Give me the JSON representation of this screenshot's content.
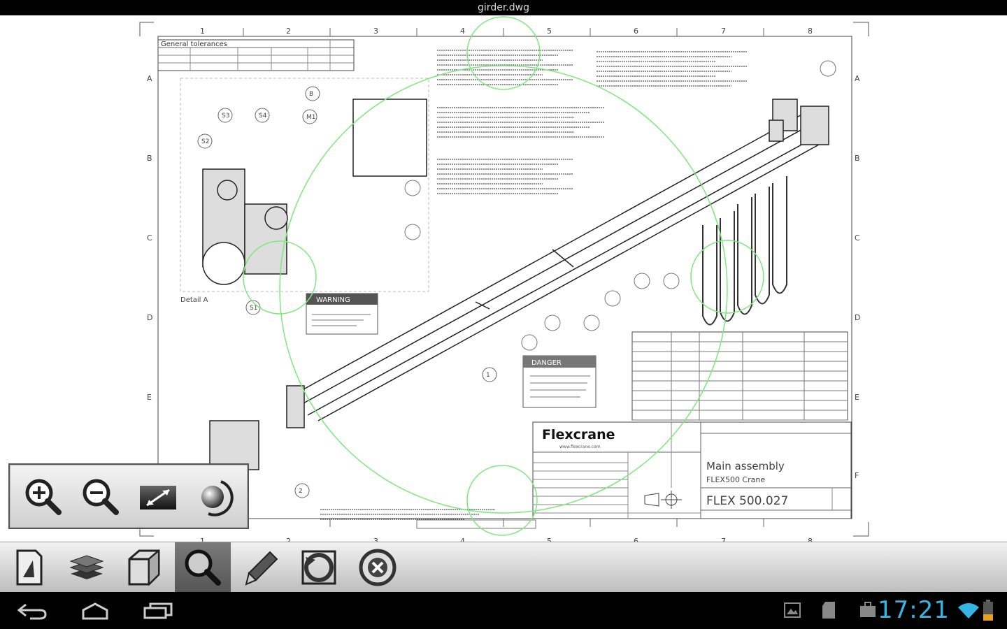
{
  "window": {
    "title": "girder.dwg"
  },
  "drawing": {
    "col_labels": [
      "1",
      "2",
      "3",
      "4",
      "5",
      "6",
      "7",
      "8"
    ],
    "row_labels": [
      "A",
      "B",
      "C",
      "D",
      "E",
      "F"
    ],
    "tolerances_title": "General tolerances",
    "detail_label": "Detail A",
    "balloons": [
      "B",
      "S3",
      "S4",
      "M1",
      "S2",
      "S1",
      "1",
      "2"
    ],
    "warning_label": "WARNING",
    "danger_label": "DANGER",
    "brand": "Flexcrane",
    "brand_url": "www.flexcrane.com",
    "title_line1": "Main assembly",
    "title_line2": "FLEX500 Crane",
    "drawing_number": "FLEX 500.027"
  },
  "zoom_tools": [
    {
      "name": "zoom-in",
      "icon": "zoom-in-icon"
    },
    {
      "name": "zoom-out",
      "icon": "zoom-out-icon"
    },
    {
      "name": "zoom-extents",
      "icon": "zoom-extents-icon"
    },
    {
      "name": "orbit",
      "icon": "orbit-icon"
    }
  ],
  "toolbar": [
    {
      "name": "file",
      "icon": "document-icon"
    },
    {
      "name": "layers",
      "icon": "layers-icon"
    },
    {
      "name": "3d-view",
      "icon": "cube-icon"
    },
    {
      "name": "zoom",
      "icon": "magnifier-icon",
      "active": true
    },
    {
      "name": "markup",
      "icon": "pencil-icon"
    },
    {
      "name": "rotate",
      "icon": "rotate-icon"
    },
    {
      "name": "close",
      "icon": "close-circle-icon"
    }
  ],
  "status": {
    "time": "17:21"
  },
  "colors": {
    "accent": "#33b5e5",
    "overlay_circle": "#7ee87e"
  }
}
